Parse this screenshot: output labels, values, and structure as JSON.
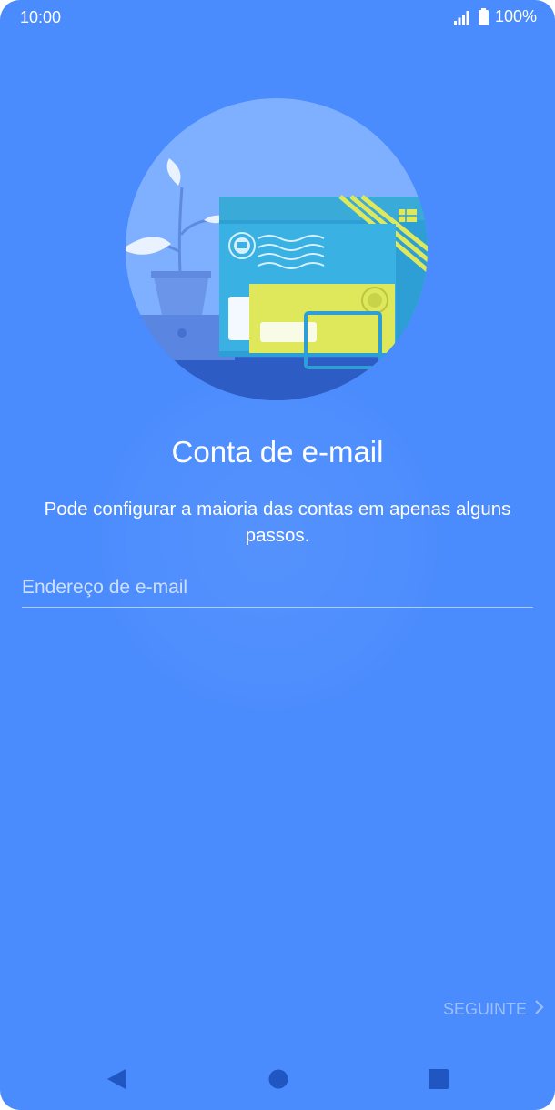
{
  "status_bar": {
    "time": "10:00",
    "battery": "100%",
    "icons": [
      "signal-icon",
      "battery-icon"
    ]
  },
  "hero": {
    "icon": "email-illustration"
  },
  "screen": {
    "title": "Conta de e-mail",
    "subtitle": "Pode configurar a maioria das contas em apenas alguns passos."
  },
  "form": {
    "email_placeholder": "Endereço de e-mail",
    "email_value": ""
  },
  "actions": {
    "next_label": "SEGUINTE",
    "next_icon": "chevron-right-icon"
  },
  "nav_bar": {
    "icons": [
      "back-icon",
      "home-icon",
      "recents-icon"
    ]
  },
  "colors": {
    "background": "#4a8bfd",
    "circle": "#7fb0ff",
    "nav_icons": "#1f56c2"
  }
}
